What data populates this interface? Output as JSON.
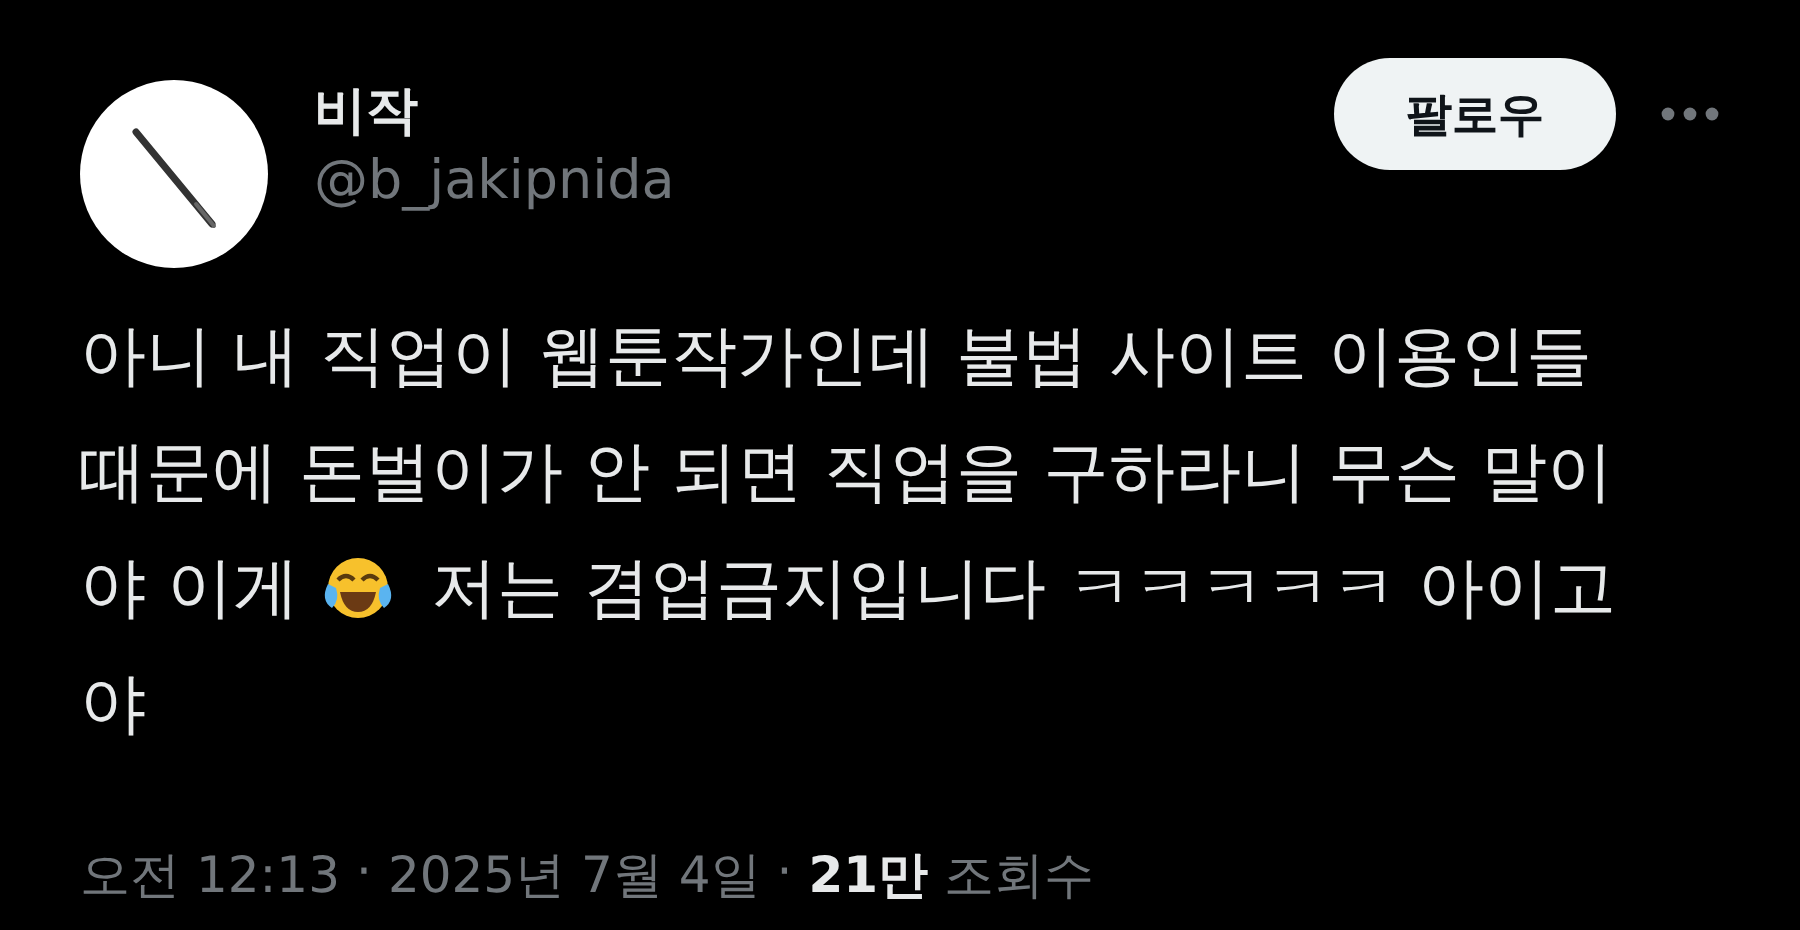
{
  "author": {
    "name": "비작",
    "handle": "@b_jakipnida"
  },
  "follow_button": {
    "label": "팔로우"
  },
  "body_lines": [
    [
      {
        "kind": "text",
        "text": "아니 내 직업이 웹툰작가인데 불법 사이트 이용인들"
      }
    ],
    [
      {
        "kind": "text",
        "text": "때문에 돈벌이가 안 되면 직업을 구하라니 무슨 말이"
      }
    ],
    [
      {
        "kind": "text",
        "text": "야 이게"
      },
      {
        "kind": "emoji"
      },
      {
        "kind": "text",
        "text": "저는 겸업금지입니다 ㅋㅋㅋㅋㅋ 아이고"
      }
    ],
    [
      {
        "kind": "text",
        "text": "야"
      }
    ]
  ],
  "meta": [
    {
      "kind": "time",
      "text": "오전 12:13"
    },
    {
      "kind": "separator",
      "text": "·"
    },
    {
      "kind": "date",
      "text": "2025년 7월 4일"
    },
    {
      "kind": "separator",
      "text": "·"
    },
    {
      "kind": "views_count",
      "text": "21만"
    },
    {
      "kind": "views_label",
      "text": "조회수"
    }
  ]
}
